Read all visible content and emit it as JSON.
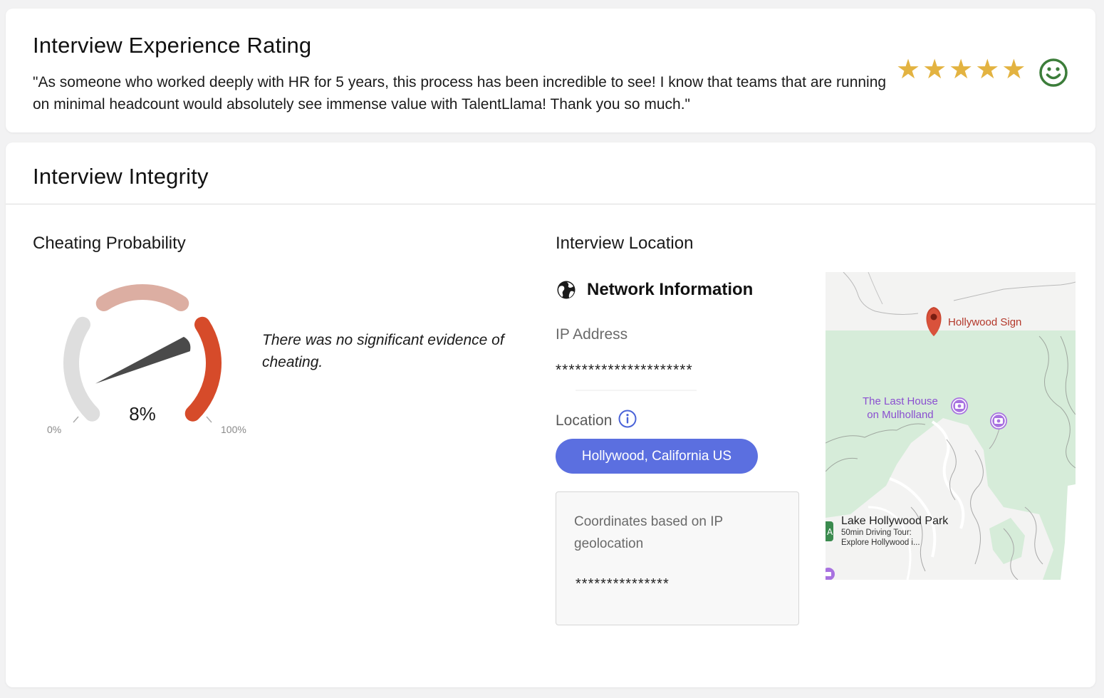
{
  "rating": {
    "title": "Interview Experience Rating",
    "quote": "\"As someone who worked deeply with HR for 5 years, this process has been incredible to see! I know that teams that are running on minimal headcount would absolutely see immense value with TalentLlama! Thank you so much.\"",
    "stars": 5,
    "star_icon": "star-icon",
    "star_color": "#e3b341",
    "sentiment_icon": "smiley-face-icon",
    "sentiment_color": "#3c7d3a"
  },
  "integrity": {
    "title": "Interview Integrity",
    "cheating": {
      "label": "Cheating Probability",
      "value": 8,
      "value_text": "8%",
      "min_label": "0%",
      "max_label": "100%",
      "description": "There was no significant evidence of cheating.",
      "colors": {
        "low": "#dedede",
        "mid": "#dcaea2",
        "high": "#d64b2a",
        "needle": "#4a4a4a"
      }
    },
    "location": {
      "label": "Interview Location",
      "network_title": "Network Information",
      "network_icon": "globe-icon",
      "ip_label": "IP Address",
      "ip_value": "*********************",
      "location_label": "Location",
      "location_info_icon": "info-icon",
      "location_value": "Hollywood, California US",
      "pill_color": "#5b6fe0",
      "coordinates_label": "Coordinates based on IP geolocation",
      "coordinates_value": "***************"
    },
    "map": {
      "pin_label": "Hollywood Sign",
      "poi1_line1": "The Last House",
      "poi1_line2": "on Mulholland",
      "park_name": "Lake Hollywood Park",
      "park_sub1": "50min Driving Tour:",
      "park_sub2": "Explore Hollywood i..."
    }
  }
}
